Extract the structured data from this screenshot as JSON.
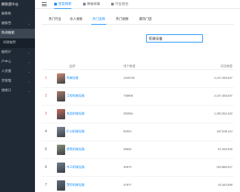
{
  "sidebar": {
    "title": "腾数据中台",
    "items": [
      {
        "label": "据看板",
        "chevron": "",
        "state": ""
      },
      {
        "label": "据报告",
        "chevron": "⌄",
        "state": ""
      },
      {
        "label": "热词搜索",
        "chevron": "",
        "state": "active"
      },
      {
        "label": "词语推荐",
        "chevron": "",
        "state": "sub"
      },
      {
        "label": "据统计",
        "chevron": "⌄",
        "state": ""
      },
      {
        "label": "户中心",
        "chevron": "⌄",
        "state": ""
      },
      {
        "label": "人流量",
        "chevron": "⌄",
        "state": ""
      },
      {
        "label": "页管理",
        "chevron": "⌄",
        "state": ""
      },
      {
        "label": "搜接口",
        "chevron": "⌄",
        "state": ""
      }
    ]
  },
  "topbar": {
    "tabs": [
      {
        "label": "百度搜索",
        "active": true
      },
      {
        "label": "数据采集",
        "active": false
      },
      {
        "label": "行业后台",
        "active": false
      }
    ]
  },
  "subtabs": [
    {
      "label": "热门行业",
      "active": false
    },
    {
      "label": "达人搜索",
      "active": false
    },
    {
      "label": "热门品牌",
      "active": true
    },
    {
      "label": "热门视频",
      "active": false
    },
    {
      "label": "最热门店",
      "active": false
    }
  ],
  "search": {
    "value": "机械设备"
  },
  "table": {
    "headers": [
      "品牌",
      "用户数量",
      "浏览数量"
    ],
    "rows": [
      {
        "rank": "1",
        "name": "机械设备",
        "users": "1418740",
        "browse": "2,147,483,647",
        "rank_color": "#e15b5b",
        "thumb_color": "#cf8e73"
      },
      {
        "rank": "2",
        "name": "工程机械设备",
        "users": "736906",
        "browse": "2,147,483,647",
        "rank_color": "#e15b5b",
        "thumb_color": "#a97a6a"
      },
      {
        "rank": "3",
        "name": "食品机械设备",
        "users": "282591",
        "browse": "1,180,254,422",
        "rank_color": "#e15b5b",
        "thumb_color": "#c46b5b"
      },
      {
        "rank": "4",
        "name": "矿山机械设备",
        "users": "82024",
        "browse": "187,546,114",
        "rank_color": "#555555",
        "thumb_color": "#7d8a99"
      },
      {
        "rank": "5",
        "name": "建筑机械设备",
        "users": "39832",
        "browse": "97,333,929",
        "rank_color": "#555555",
        "thumb_color": "#8b8f7c"
      },
      {
        "rank": "6",
        "name": "木工机械设备",
        "users": "30573",
        "browse": "103,886,517",
        "rank_color": "#555555",
        "thumb_color": "#6f7e8c"
      },
      {
        "rank": "7",
        "name": "塑料机械设备",
        "users": "37977",
        "browse": "42,343,059",
        "rank_color": "#555555",
        "thumb_color": "#5f6b78"
      }
    ]
  }
}
